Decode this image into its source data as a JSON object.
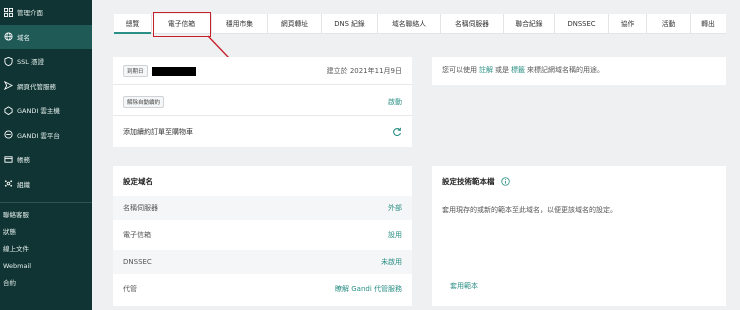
{
  "sidebar": {
    "items": [
      {
        "label": "管理介面",
        "icon": "grid-icon"
      },
      {
        "label": "域名",
        "icon": "globe-icon"
      },
      {
        "label": "SSL 憑證",
        "icon": "shield-icon"
      },
      {
        "label": "網頁代管服務",
        "icon": "server-icon"
      },
      {
        "label": "GANDI 雲主機",
        "icon": "cloud-icon"
      },
      {
        "label": "GANDI 雲平台",
        "icon": "cloud-platform-icon"
      },
      {
        "label": "帳務",
        "icon": "bill-icon"
      },
      {
        "label": "組織",
        "icon": "org-icon"
      }
    ],
    "links": [
      "聯絡客服",
      "狀態",
      "線上文件",
      "Webmail",
      "合約"
    ]
  },
  "tabs": [
    "總覽",
    "電子信箱",
    "穩用市集",
    "網頁轉址",
    "DNS 紀錄",
    "域名聯絡人",
    "名稱伺服器",
    "聯合紀錄",
    "DNSSEC",
    "協作",
    "活動",
    "轉出"
  ],
  "overview": {
    "expiry_tag": "到期日",
    "created_text": "建立於 2021年11月9日",
    "auto_renew_tag": "解除自動續約",
    "auto_renew_action": "啟動",
    "add_to_cart": "添加續約訂單至購物車"
  },
  "info": {
    "prefix": "您可以使用",
    "link1": "註解",
    "middle": "或是",
    "link2": "標籤",
    "suffix": "來標記網域名稱的用途。"
  },
  "configure": {
    "title": "設定域名",
    "rows": [
      {
        "label": "名稱伺服器",
        "value": "外部"
      },
      {
        "label": "電子信箱",
        "value": "設用"
      },
      {
        "label": "DNSSEC",
        "value": "未啟用"
      },
      {
        "label": "代管",
        "value": "瞭解 Gandi 代管服務"
      }
    ]
  },
  "template": {
    "title": "設定技術範本檔",
    "desc": "套用現存的或新的範本至此域名，以便更該域名的設定。",
    "link": "套用範本"
  },
  "colors": {
    "accent": "#2a8f84",
    "sidebar": "#0f3433",
    "highlight": "#c8202a"
  }
}
